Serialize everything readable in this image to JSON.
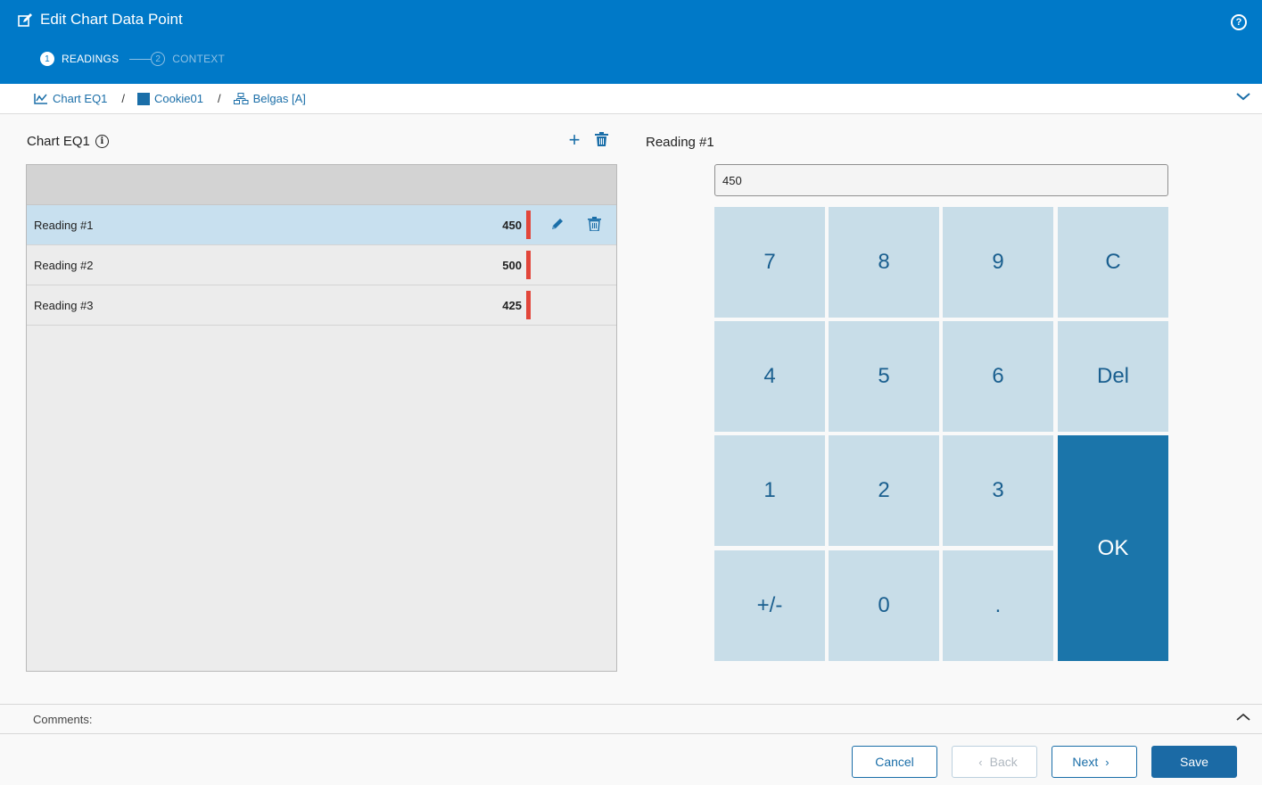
{
  "header": {
    "title": "Edit Chart Data Point",
    "help_icon": "?",
    "steps": [
      {
        "num": "1",
        "label": "READINGS",
        "active": true
      },
      {
        "num": "2",
        "label": "CONTEXT",
        "active": false
      }
    ]
  },
  "breadcrumb": {
    "items": [
      {
        "label": "Chart EQ1",
        "icon": "chart-icon"
      },
      {
        "label": "Cookie01",
        "icon": "square-icon"
      },
      {
        "label": "Belgas [A]",
        "icon": "hierarchy-icon"
      }
    ],
    "separator": "/"
  },
  "left": {
    "title": "Chart EQ1",
    "info_icon": "i",
    "add_label": "+",
    "readings": [
      {
        "name": "Reading #1",
        "value": "450",
        "selected": true
      },
      {
        "name": "Reading #2",
        "value": "500",
        "selected": false
      },
      {
        "name": "Reading #3",
        "value": "425",
        "selected": false
      }
    ]
  },
  "right": {
    "title": "Reading #1",
    "input_value": "450",
    "keys": {
      "k7": "7",
      "k8": "8",
      "k9": "9",
      "clear": "C",
      "k4": "4",
      "k5": "5",
      "k6": "6",
      "del": "Del",
      "k1": "1",
      "k2": "2",
      "k3": "3",
      "ok": "OK",
      "plusminus": "+/-",
      "k0": "0",
      "dot": "."
    }
  },
  "comments": {
    "label": "Comments:"
  },
  "footer": {
    "cancel": "Cancel",
    "back": "Back",
    "back_chevron": "‹",
    "next": "Next",
    "next_chevron": "›",
    "save": "Save"
  },
  "colors": {
    "header_bg": "#0079c8",
    "accent": "#1a6ea8",
    "selected_row": "#c8e0ef",
    "marker": "#e2463a",
    "keypad_key": "#c8dde8",
    "ok_key": "#1b75aa"
  }
}
